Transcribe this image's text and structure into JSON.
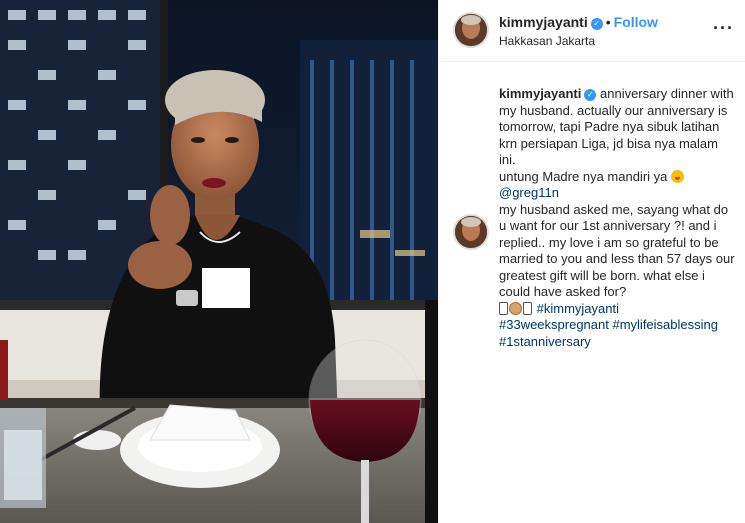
{
  "post": {
    "username": "kimmyjayanti",
    "verified_icon": "verified-badge-icon",
    "separator": "•",
    "follow_label": "Follow",
    "location": "Hakkasan Jakarta",
    "more_label": "···",
    "censor_color": "#ffffff"
  },
  "caption": {
    "line1": "anniversary dinner with my husband. actually our anniversary is tomorrow, tapi Padre nya sibuk latihan krn persiapan Liga, jd bisa nya malam ini.",
    "line2": "untung Madre nya mandiri ya",
    "line2_emoji": "tongue-out-emoji",
    "mention": "@greg11n",
    "line3": "my husband asked me, sayang what do u want for our 1st anniversary ?! and i replied.. my love i am so grateful to be married to you and less than 57 days our greatest gift will be born. what else i could have asked for?",
    "hashtags": [
      "#kimmyjayanti",
      "#33weekspregnant",
      "#mylifeisablessing",
      "#1stanniversary"
    ]
  },
  "colors": {
    "accent": "#3897f0",
    "link": "#003569",
    "text": "#262626",
    "border": "#efefef"
  }
}
